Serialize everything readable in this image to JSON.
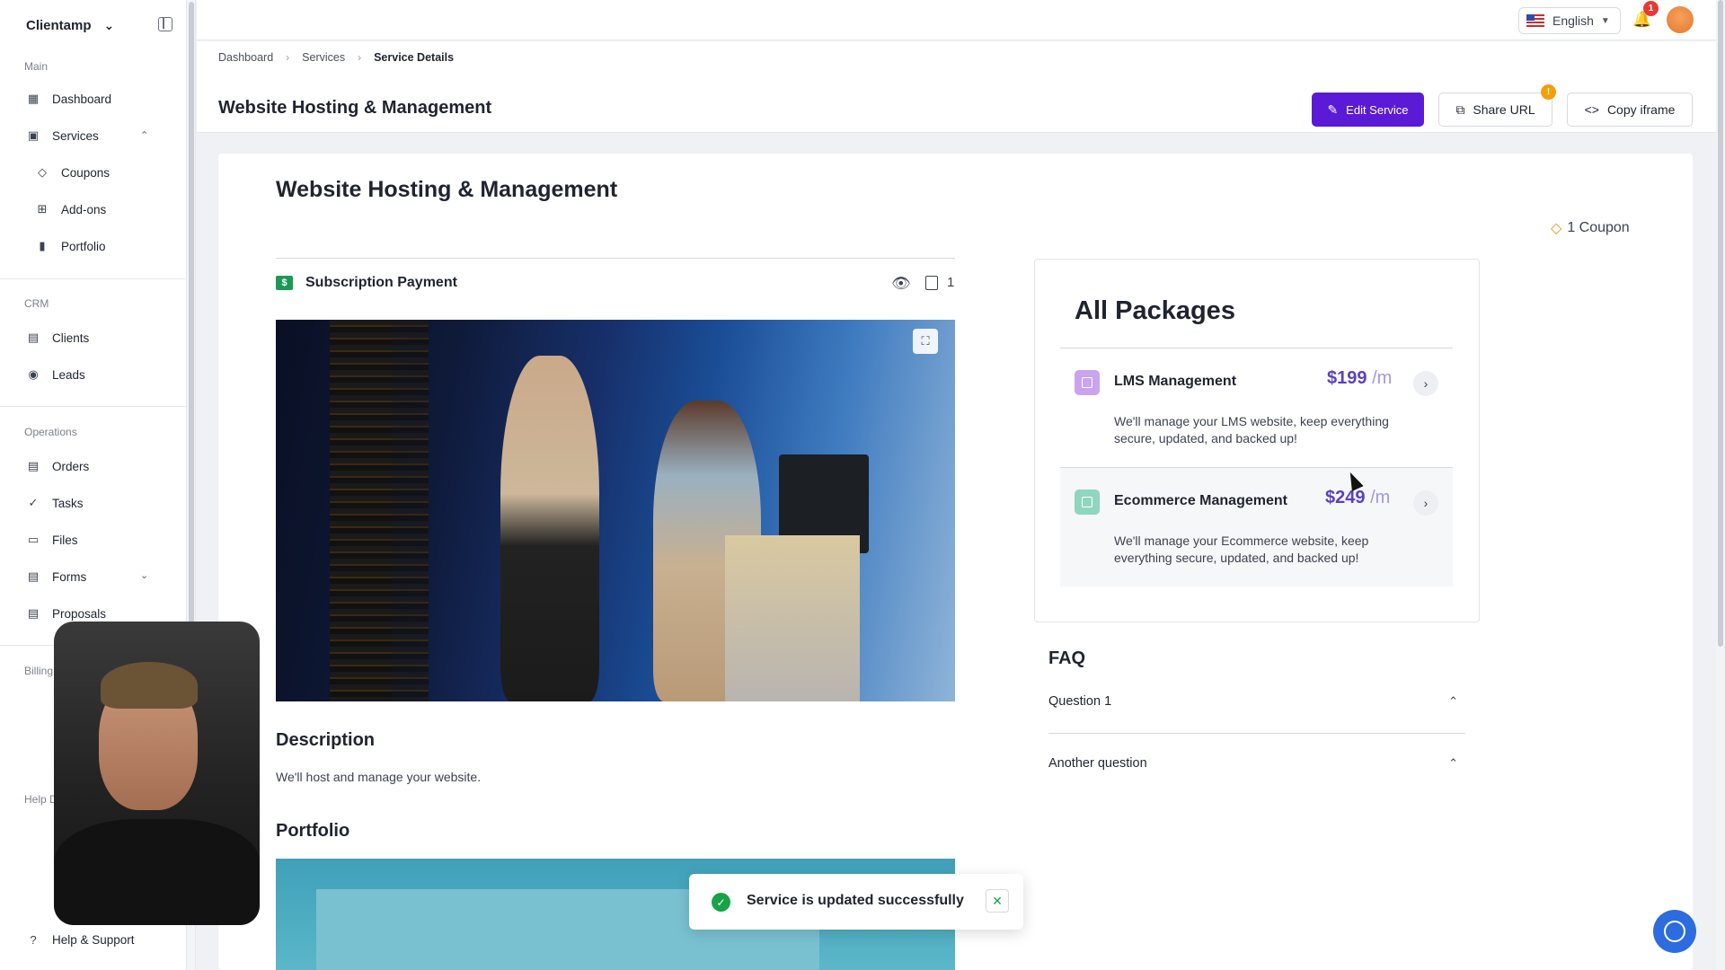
{
  "sidebar": {
    "brand": "Clientamp",
    "sections": {
      "main": "Main",
      "crm": "CRM",
      "operations": "Operations",
      "billing": "Billing",
      "help": "Help D"
    },
    "items": {
      "dashboard": "Dashboard",
      "services": "Services",
      "coupons": "Coupons",
      "addons": "Add-ons",
      "portfolio": "Portfolio",
      "clients": "Clients",
      "leads": "Leads",
      "orders": "Orders",
      "tasks": "Tasks",
      "files": "Files",
      "forms": "Forms",
      "proposals": "Proposals",
      "help_support": "Help & Support"
    }
  },
  "topbar": {
    "language": "English",
    "notification_count": "1"
  },
  "breadcrumb": [
    "Dashboard",
    "Services",
    "Service Details"
  ],
  "header": {
    "title": "Website Hosting & Management",
    "edit_label": "Edit Service",
    "share_label": "Share URL",
    "share_badge": "!",
    "copy_label": "Copy iframe"
  },
  "service": {
    "title": "Website Hosting & Management",
    "coupon": "1 Coupon",
    "payment_type": "Subscription Payment",
    "count": "1",
    "description_heading": "Description",
    "description": "We'll host and manage your website.",
    "portfolio_heading": "Portfolio"
  },
  "packages": {
    "title": "All Packages",
    "items": [
      {
        "name": "LMS Management",
        "price": "$199",
        "period": "/m",
        "description": "We'll manage your LMS website, keep everything secure, updated, and backed up!",
        "icon_color": "#c9a4ef"
      },
      {
        "name": "Ecommerce Management",
        "price": "$249",
        "period": "/m",
        "description": "We'll manage your Ecommerce website, keep everything secure, updated, and backed up!",
        "icon_color": "#8fd6be"
      }
    ]
  },
  "faq": {
    "title": "FAQ",
    "questions": [
      "Question 1",
      "Another question"
    ]
  },
  "toast": {
    "message": "Service is updated successfully"
  },
  "colors": {
    "accent": "#5b1bd6",
    "price": "#5b3fc4",
    "success": "#16a34a"
  }
}
